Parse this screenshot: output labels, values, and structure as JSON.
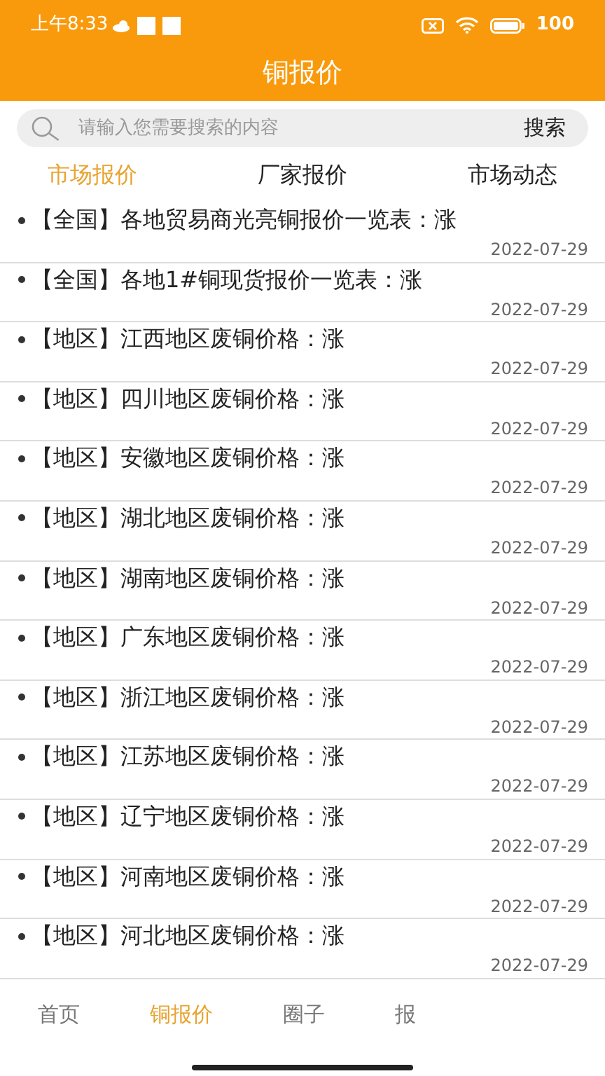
{
  "status_bar": {
    "time": "上午8:33",
    "battery": "100"
  },
  "header": {
    "title": "铜报价"
  },
  "search": {
    "placeholder": "请输入您需要搜索的内容",
    "button": "搜索"
  },
  "tabs": [
    {
      "label": "市场报价",
      "selected": true
    },
    {
      "label": "厂家报价",
      "selected": false
    },
    {
      "label": "市场动态",
      "selected": false
    }
  ],
  "articles": [
    {
      "title": "【全国】各地贸易商光亮铜报价一览表：涨",
      "date": "2022-07-29"
    },
    {
      "title": "【全国】各地1#铜现货报价一览表：涨",
      "date": "2022-07-29"
    },
    {
      "title": "【地区】江西地区废铜价格：涨",
      "date": "2022-07-29"
    },
    {
      "title": "【地区】四川地区废铜价格：涨",
      "date": "2022-07-29"
    },
    {
      "title": "【地区】安徽地区废铜价格：涨",
      "date": "2022-07-29"
    },
    {
      "title": "【地区】湖北地区废铜价格：涨",
      "date": "2022-07-29"
    },
    {
      "title": "【地区】湖南地区废铜价格：涨",
      "date": "2022-07-29"
    },
    {
      "title": "【地区】广东地区废铜价格：涨",
      "date": "2022-07-29"
    },
    {
      "title": "【地区】浙江地区废铜价格：涨",
      "date": "2022-07-29"
    },
    {
      "title": "【地区】江苏地区废铜价格：涨",
      "date": "2022-07-29"
    },
    {
      "title": "【地区】辽宁地区废铜价格：涨",
      "date": "2022-07-29"
    },
    {
      "title": "【地区】河南地区废铜价格：涨",
      "date": "2022-07-29"
    },
    {
      "title": "【地区】河北地区废铜价格：涨",
      "date": "2022-07-29"
    }
  ],
  "bottom_nav": [
    {
      "label": "首页",
      "selected": false
    },
    {
      "label": "铜报价",
      "selected": true
    },
    {
      "label": "圈子",
      "selected": false
    },
    {
      "label": "报",
      "selected": false
    }
  ]
}
